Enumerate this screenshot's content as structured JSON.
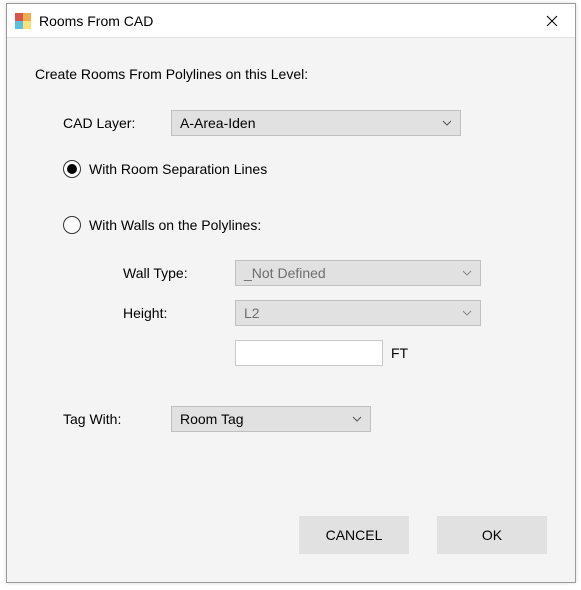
{
  "window": {
    "title": "Rooms From CAD"
  },
  "heading": "Create Rooms From Polylines on this Level:",
  "layer": {
    "label": "CAD Layer:",
    "value": "A-Area-Iden"
  },
  "option_separation": {
    "label": "With Room Separation Lines",
    "selected": true
  },
  "option_walls": {
    "label": "With Walls on the Polylines:",
    "selected": false
  },
  "walltype": {
    "label": "Wall Type:",
    "value": "_Not Defined"
  },
  "height": {
    "label": "Height:",
    "value": "L2"
  },
  "height_unit": {
    "value": "",
    "unit": "FT"
  },
  "tag": {
    "label": "Tag With:",
    "value": "Room Tag"
  },
  "buttons": {
    "cancel": "CANCEL",
    "ok": "OK"
  }
}
